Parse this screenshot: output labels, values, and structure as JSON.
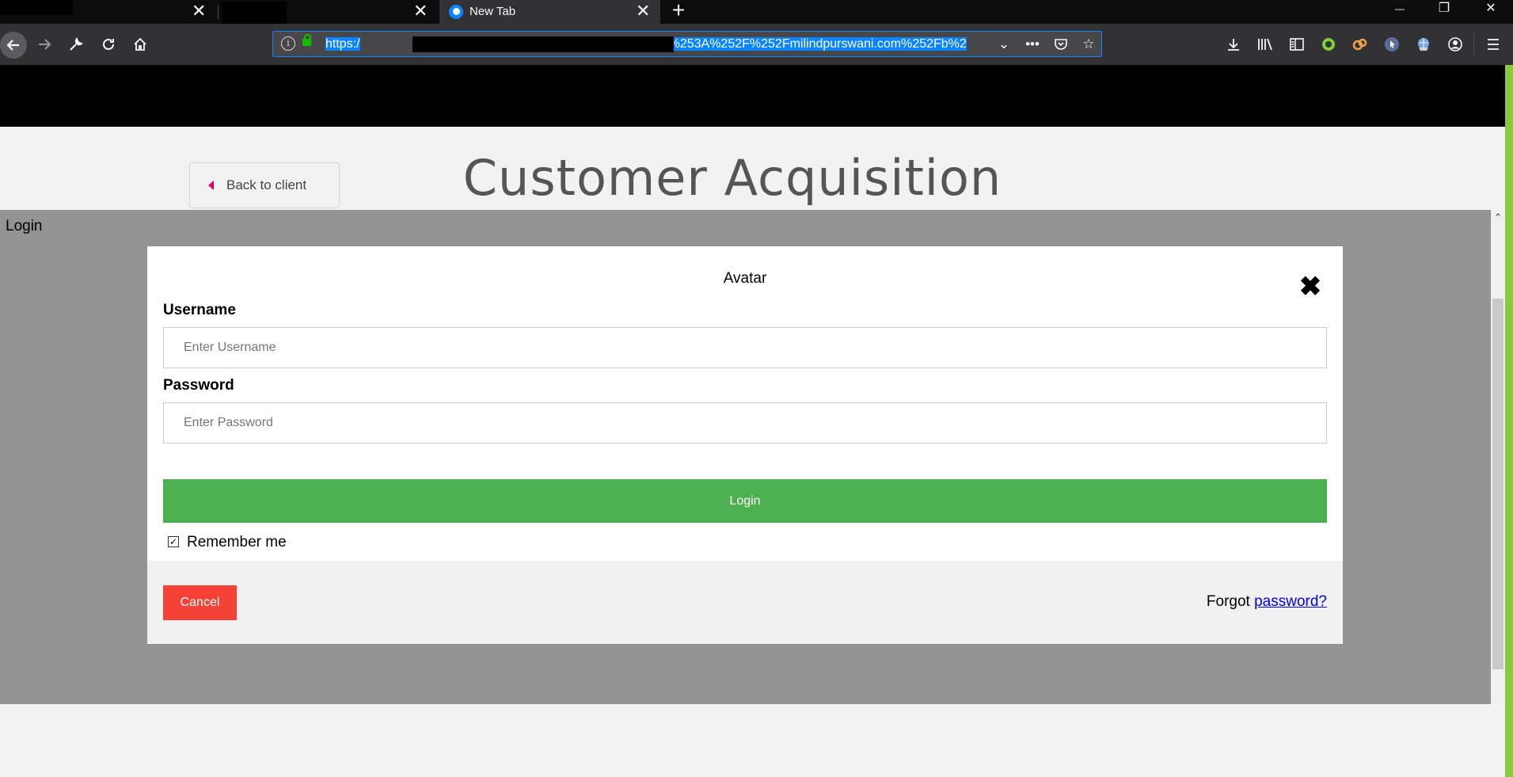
{
  "browser": {
    "tabs": [
      {
        "label": "",
        "close": "✕"
      },
      {
        "label": "",
        "close": "✕"
      },
      {
        "label": "New Tab",
        "close": "✕"
      }
    ],
    "new_tab_glyph": "+",
    "window_controls": {
      "minimize": "—",
      "restore": "❐",
      "close": "✕"
    },
    "url": {
      "prefix": "https:/",
      "suffix": "=https%253A%252F%252Fmilindpurswani.com%252Fb%2"
    },
    "toolbar_icons": [
      "download-icon",
      "library-icon",
      "sidebar-icon",
      "extension-green-icon",
      "extension-orange-icon",
      "extension-cursor-icon",
      "extension-globe-icon",
      "account-icon",
      "menu-icon"
    ]
  },
  "page": {
    "back_button_label": "Back to client",
    "title": "Customer Acquisition",
    "overlay_label": "Login"
  },
  "modal": {
    "title": "Avatar",
    "close_glyph": "✖",
    "username_label": "Username",
    "username_placeholder": "Enter Username",
    "username_value": "",
    "password_label": "Password",
    "password_placeholder": "Enter Password",
    "password_value": "",
    "login_label": "Login",
    "remember_checked": true,
    "remember_label": "Remember me",
    "cancel_label": "Cancel",
    "forgot_prefix": "Forgot",
    "forgot_link": "password?"
  },
  "colors": {
    "login_button": "#4caf50",
    "cancel_button": "#f44336",
    "url_selection": "#0a84ff",
    "accent_edge": "#8dc63f"
  }
}
